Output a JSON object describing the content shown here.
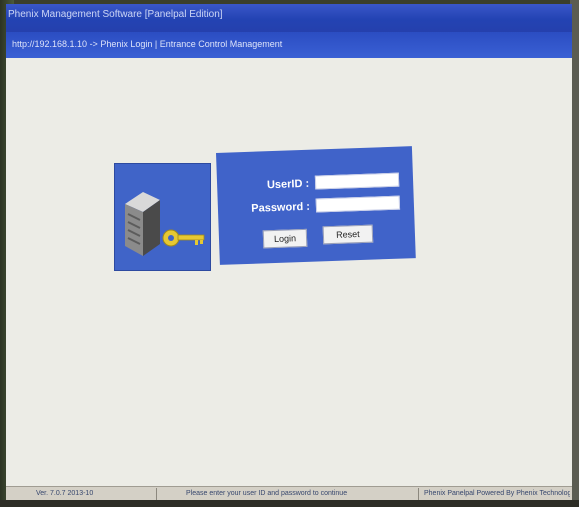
{
  "window": {
    "title": "Phenix Management Software [Panelpal Edition]",
    "address": "http://192.168.1.10 -> Phenix Login | Entrance Control Management"
  },
  "login": {
    "userid_label": "UserID :",
    "password_label": "Password :",
    "userid_value": "",
    "password_value": "",
    "login_button": "Login",
    "reset_button": "Reset"
  },
  "statusbar": {
    "left": "Ver. 7.0.7  2013-10",
    "middle": "Please enter your user ID and password to continue",
    "right": "Phenix Panelpal Powered By Phenix Technology"
  },
  "colors": {
    "titlebar": "#2343b3",
    "panel": "#4063c9",
    "page": "#ecece6"
  },
  "icons": {
    "login_image": "server-with-key-icon"
  }
}
